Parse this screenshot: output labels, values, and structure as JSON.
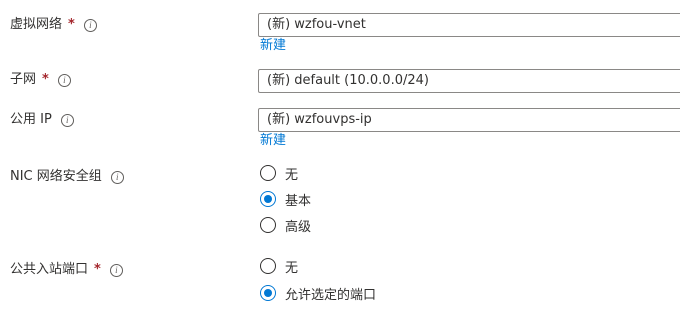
{
  "fields": {
    "vnet": {
      "label": "虚拟网络",
      "required_mark": "*",
      "info_glyph": "i",
      "value": "(新) wzfou-vnet",
      "create_link": "新建"
    },
    "subnet": {
      "label": "子网",
      "required_mark": "*",
      "info_glyph": "i",
      "value": "(新) default (10.0.0.0/24)"
    },
    "public_ip": {
      "label": "公用 IP",
      "info_glyph": "i",
      "value": "(新) wzfouvps-ip",
      "create_link": "新建"
    },
    "nic_nsg": {
      "label": "NIC 网络安全组",
      "info_glyph": "i",
      "options": [
        "无",
        "基本",
        "高级"
      ],
      "selected": "基本"
    },
    "public_inbound_ports": {
      "label": "公共入站端口",
      "required_mark": "*",
      "info_glyph": "i",
      "options": [
        "无",
        "允许选定的端口"
      ],
      "selected": "允许选定的端口"
    }
  },
  "colors": {
    "link": "#0078d4",
    "radio_selected": "#0078d4",
    "required": "#a4262c",
    "border": "#8a8886"
  }
}
